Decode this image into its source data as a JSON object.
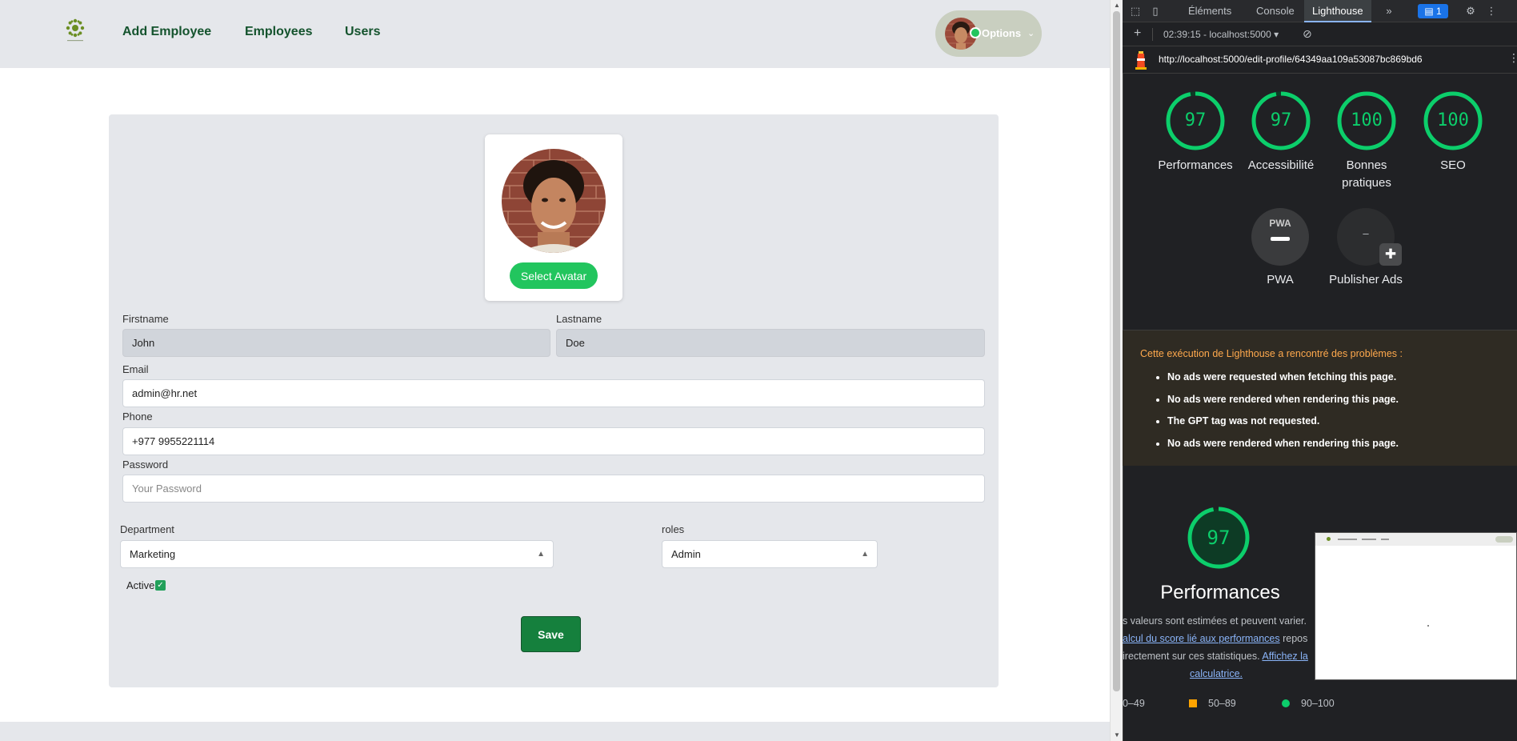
{
  "nav": {
    "links": [
      "Add Employee",
      "Employees",
      "Users"
    ],
    "options_label": "Options"
  },
  "profile": {
    "select_avatar_label": "Select Avatar",
    "firstname_label": "Firstname",
    "firstname_value": "John",
    "lastname_label": "Lastname",
    "lastname_value": "Doe",
    "email_label": "Email",
    "email_value": "admin@hr.net",
    "phone_label": "Phone",
    "phone_value": "+977 9955221114",
    "password_label": "Password",
    "password_placeholder": "Your Password",
    "department_label": "Department",
    "department_value": "Marketing",
    "roles_label": "roles",
    "roles_value": "Admin",
    "active_label": "Active",
    "active_checked": true,
    "save_label": "Save"
  },
  "devtools": {
    "tabs": [
      "Éléments",
      "Console",
      "Lighthouse"
    ],
    "active_tab": "Lighthouse",
    "more_tabs_icon": "chevron-double-right-icon",
    "issues_badge": "1",
    "run_label": "02:39:15 - localhost:5000",
    "report_url": "http://localhost:5000/edit-profile/64349aa109a53087bc869bd6",
    "scores": [
      {
        "value": "97",
        "label": "Performances"
      },
      {
        "value": "97",
        "label": "Accessibilité"
      },
      {
        "value": "100",
        "label": "Bonnes pratiques"
      },
      {
        "value": "100",
        "label": "SEO"
      }
    ],
    "pwa_label": "PWA",
    "pwa_badge": "PWA",
    "publisher_label": "Publisher Ads",
    "publisher_value": "–",
    "warning_title": "Cette exécution de Lighthouse a rencontré des problèmes :",
    "warnings": [
      "No ads were requested when fetching this page.",
      "No ads were rendered when rendering this page.",
      "The GPT tag was not requested.",
      "No ads were rendered when rendering this page."
    ],
    "perf_score": "97",
    "perf_title": "Performances",
    "perf_note_1": "s valeurs sont estimées et peuvent varier.",
    "perf_note_2_link": "alcul du score lié aux performances",
    "perf_note_2_rest": " repos",
    "perf_note_3": "irectement sur ces statistiques.",
    "perf_note_3_link": "Affichez la",
    "perf_note_4_link": "calculatrice.",
    "legend": [
      "0–49",
      "50–89",
      "90–100"
    ],
    "colors": {
      "pass": "#0cce6b",
      "average": "#ffa400",
      "fail": "#ff4e42",
      "accent": "#22c55e",
      "save": "#15803d"
    }
  }
}
